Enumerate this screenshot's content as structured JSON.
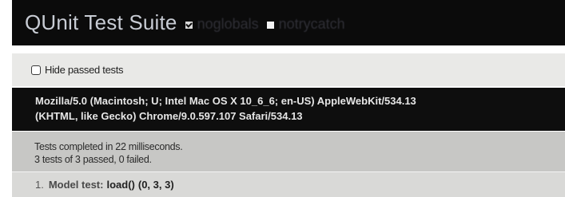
{
  "header": {
    "title": "QUnit Test Suite",
    "noglobals_label": "noglobals",
    "notrycatch_label": "notrycatch",
    "noglobals_checked": true,
    "notrycatch_checked": false
  },
  "toolbar": {
    "hide_passed_label": "Hide passed tests"
  },
  "useragent": {
    "line1": "Mozilla/5.0 (Macintosh; U; Intel Mac OS X 10_6_6; en-US) AppleWebKit/534.13",
    "line2": "(KHTML, like Gecko) Chrome/9.0.597.107 Safari/534.13"
  },
  "results": {
    "line1": "Tests completed in 22 milliseconds.",
    "line2": "3 tests of 3 passed, 0 failed."
  },
  "tests": [
    {
      "number": "1.",
      "module": "Model test:",
      "name": "load()",
      "counts": "(0, 3, 3)"
    }
  ],
  "colors": {
    "header_bg": "#0b0b0b",
    "header_title": "#c8ccd4",
    "toolbar_bg": "#e9e9e7",
    "useragent_bg": "#0e0e0e",
    "results_bg": "#c7c7c5",
    "test_row_bg": "#d9d9d7"
  }
}
